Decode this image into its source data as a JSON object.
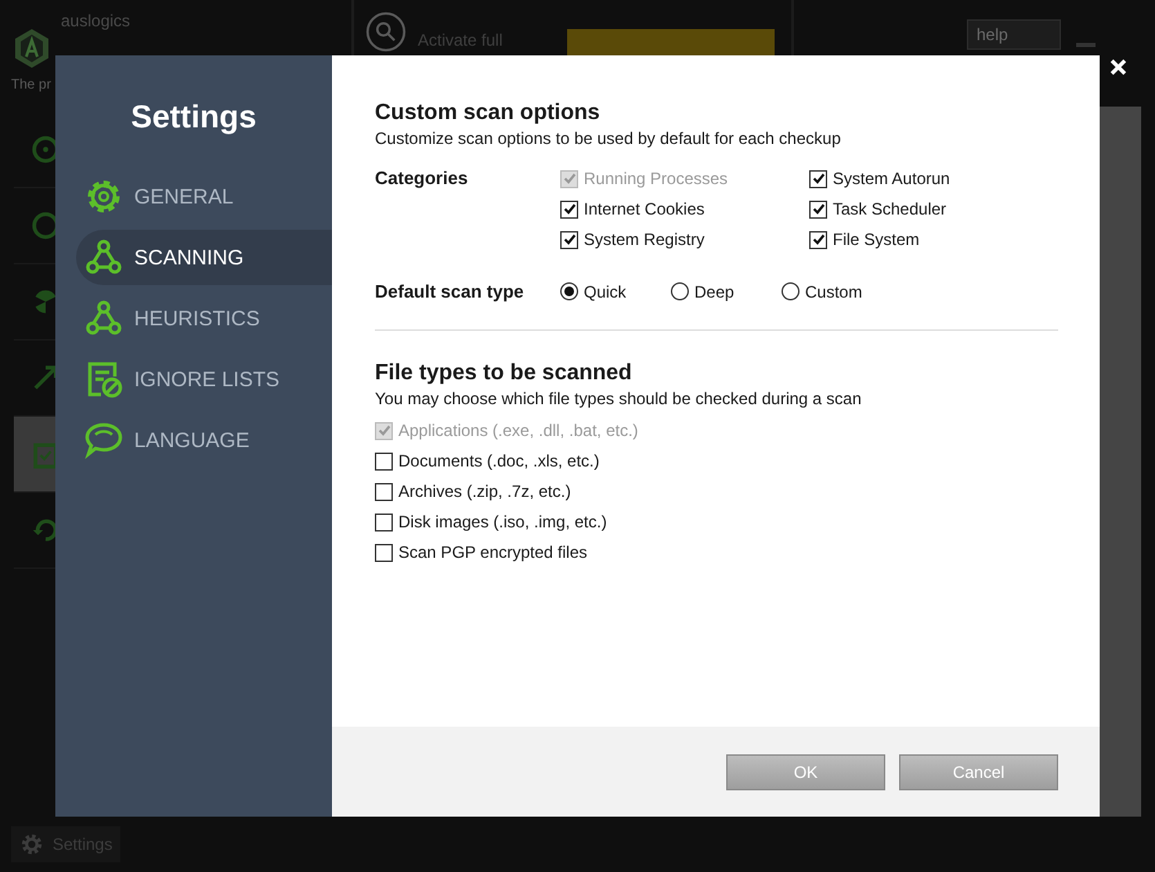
{
  "background_app": {
    "brand": "auslogics",
    "tagline": "The pr",
    "activate_text": "Activate full",
    "help_menu": "help",
    "side_items": [
      {
        "selected": false
      },
      {
        "selected": false
      },
      {
        "selected": false
      },
      {
        "selected": false
      },
      {
        "selected": true
      },
      {
        "selected": false
      }
    ],
    "footer_button": "Settings"
  },
  "settings_dialog": {
    "title": "Settings",
    "nav": [
      {
        "label": "GENERAL",
        "selected": false
      },
      {
        "label": "SCANNING",
        "selected": true
      },
      {
        "label": "HEURISTICS",
        "selected": false
      },
      {
        "label": "IGNORE LISTS",
        "selected": false
      },
      {
        "label": "LANGUAGE",
        "selected": false
      }
    ],
    "custom_scan": {
      "heading": "Custom scan options",
      "description": "Customize scan options to be used by default for each checkup",
      "categories_label": "Categories",
      "categories": [
        {
          "label": "Running Processes",
          "checked": true,
          "disabled": true
        },
        {
          "label": "System Autorun",
          "checked": true,
          "disabled": false
        },
        {
          "label": "Internet Cookies",
          "checked": true,
          "disabled": false
        },
        {
          "label": "Task Scheduler",
          "checked": true,
          "disabled": false
        },
        {
          "label": "System Registry",
          "checked": true,
          "disabled": false
        },
        {
          "label": "File System",
          "checked": true,
          "disabled": false
        }
      ],
      "scan_type_label": "Default scan type",
      "scan_types": [
        {
          "label": "Quick",
          "selected": true
        },
        {
          "label": "Deep",
          "selected": false
        },
        {
          "label": "Custom",
          "selected": false
        }
      ]
    },
    "file_types": {
      "heading": "File types to be scanned",
      "description": "You may choose which file types should be checked during a scan",
      "options": [
        {
          "label": "Applications (.exe, .dll, .bat, etc.)",
          "checked": true,
          "disabled": true
        },
        {
          "label": "Documents (.doc, .xls, etc.)",
          "checked": false,
          "disabled": false
        },
        {
          "label": "Archives (.zip, .7z, etc.)",
          "checked": false,
          "disabled": false
        },
        {
          "label": "Disk images (.iso, .img, etc.)",
          "checked": false,
          "disabled": false
        },
        {
          "label": "Scan PGP encrypted files",
          "checked": false,
          "disabled": false
        }
      ]
    },
    "buttons": [
      "OK",
      "Cancel"
    ]
  }
}
